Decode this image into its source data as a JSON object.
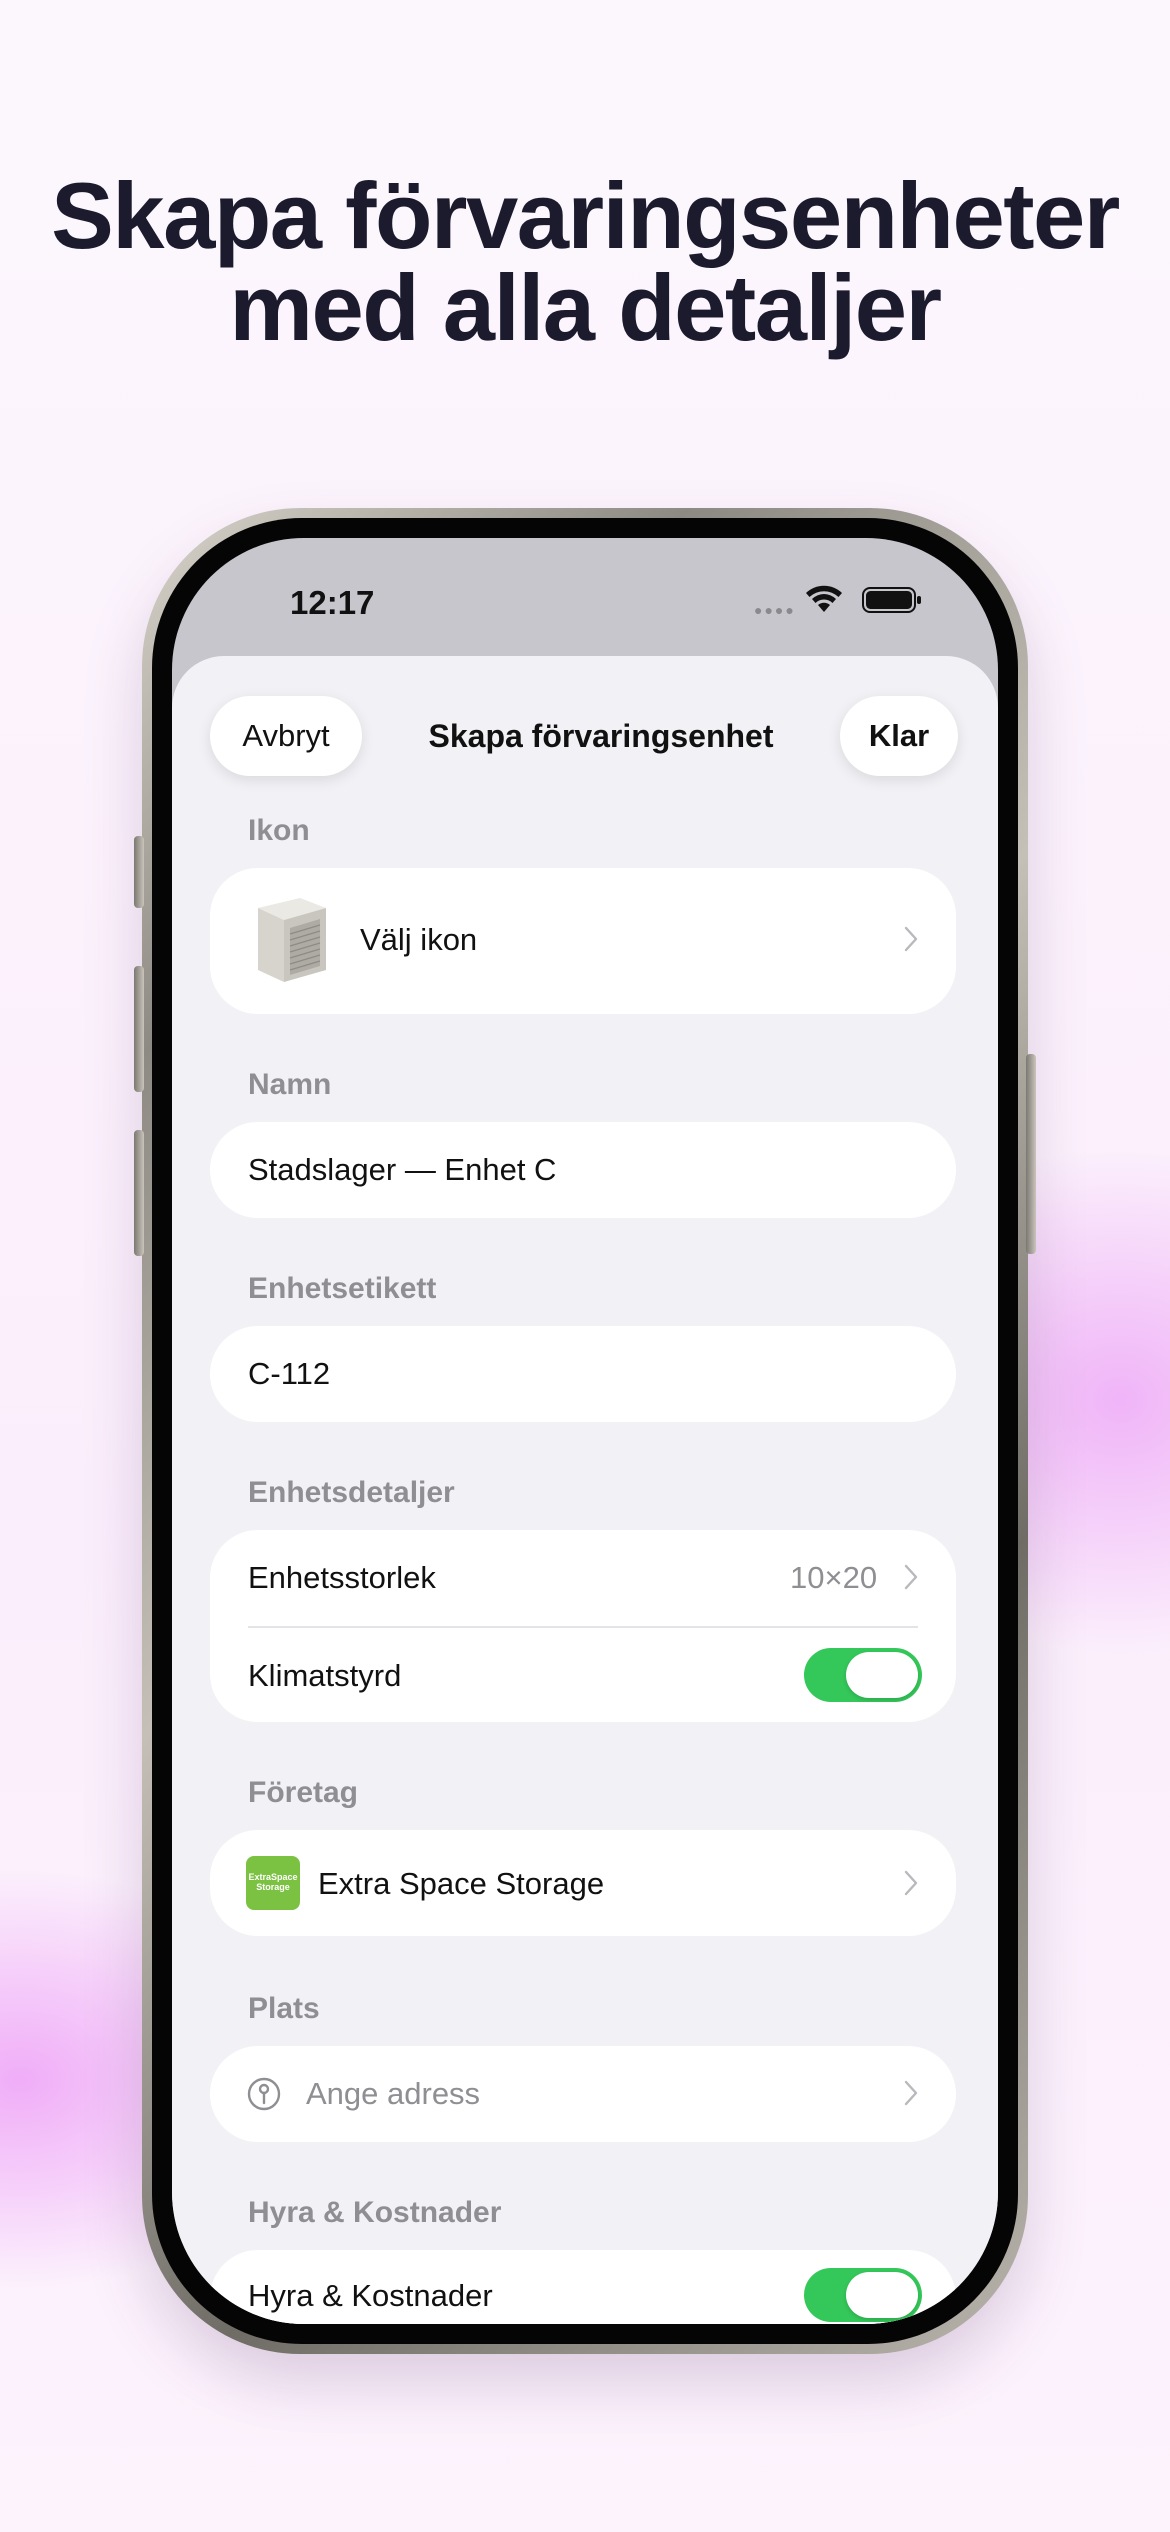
{
  "headline": {
    "line1": "Skapa förvaringsenheter",
    "line2": "med alla detaljer"
  },
  "status_bar": {
    "time": "12:17",
    "signal_icon": "cellular-dots-icon",
    "wifi_icon": "wifi-icon",
    "battery_icon": "battery-icon"
  },
  "nav": {
    "cancel_label": "Avbryt",
    "title": "Skapa förvaringsenhet",
    "done_label": "Klar"
  },
  "sections": {
    "icon": {
      "label": "Ikon",
      "choose_label": "Välj ikon",
      "preview_icon": "storage-unit-icon"
    },
    "name": {
      "label": "Namn",
      "value": "Stadslager — Enhet C"
    },
    "unit_label": {
      "label": "Enhetsetikett",
      "value": "C-112"
    },
    "details": {
      "label": "Enhetsdetaljer",
      "size_label": "Enhetsstorlek",
      "size_value": "10×20",
      "climate_label": "Klimatstyrd",
      "climate_on": true
    },
    "company": {
      "label": "Företag",
      "name": "Extra Space Storage",
      "logo_text_1": "ExtraSpace",
      "logo_text_2": "Storage",
      "logo_color": "#7cc242"
    },
    "place": {
      "label": "Plats",
      "placeholder": "Ange adress"
    },
    "rent": {
      "label": "Hyra & Kostnader",
      "row_label": "Hyra & Kostnader",
      "enabled": true
    }
  },
  "colors": {
    "accent_green": "#34c759",
    "text_primary": "#111111",
    "text_secondary": "#8e8e93"
  }
}
